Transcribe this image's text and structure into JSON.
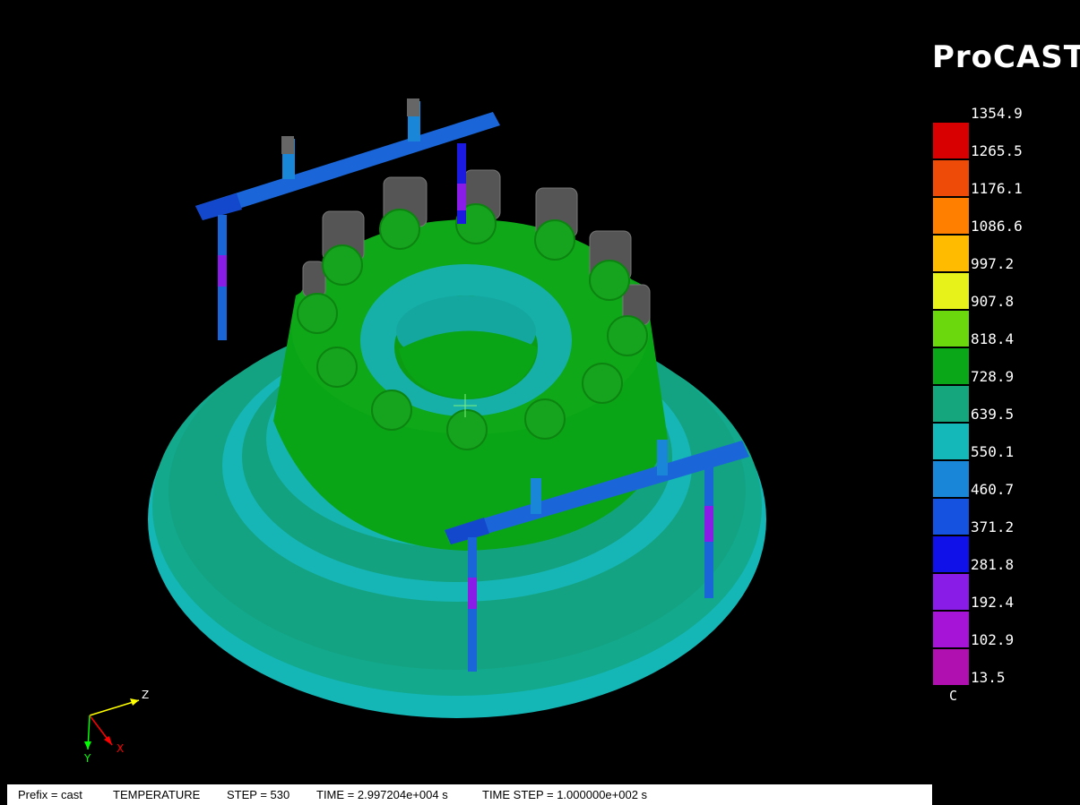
{
  "app": {
    "brand": "ProCAST"
  },
  "legend": {
    "unit": "C",
    "values": [
      "1354.9",
      "1265.5",
      "1176.1",
      "1086.6",
      "997.2",
      "907.8",
      "818.4",
      "728.9",
      "639.5",
      "550.1",
      "460.7",
      "371.2",
      "281.8",
      "192.4",
      "102.9",
      "13.5"
    ],
    "colors": [
      "#d80000",
      "#ee4a08",
      "#ff8000",
      "#ffbb00",
      "#e6f21a",
      "#6ad80c",
      "#0aa818",
      "#15a67e",
      "#15b8b8",
      "#1a86d8",
      "#1552e0",
      "#1010e8",
      "#8a1ce8",
      "#a614d8",
      "#b010b0"
    ]
  },
  "status": {
    "prefix": "Prefix = cast",
    "variable": "TEMPERATURE",
    "step": "STEP = 530",
    "time": "TIME = 2.997204e+004 s",
    "time_step": "TIME STEP = 1.000000e+002 s"
  },
  "triad": {
    "x": "X",
    "y": "Y",
    "z": "Z"
  }
}
